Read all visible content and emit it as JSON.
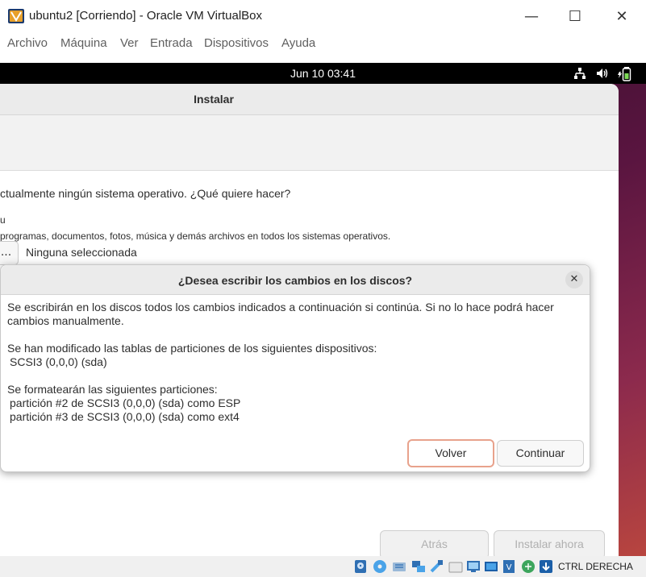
{
  "window": {
    "title": "ubuntu2 [Corriendo] - Oracle VM VirtualBox",
    "controls": {
      "minimize": "—",
      "maximize": "☐",
      "close": "✕"
    }
  },
  "menubar": {
    "items": [
      "Archivo",
      "Máquina",
      "Ver",
      "Entrada",
      "Dispositivos",
      "Ayuda"
    ]
  },
  "guest": {
    "topbar": {
      "datetime": "Jun 10  03:41"
    },
    "installer": {
      "title": "Instalar",
      "question": "ctualmente ningún sistema operativo. ¿Qué quiere hacer?",
      "option_label": "u",
      "option_desc": "programas, documentos, fotos, música y demás archivos en todos los sistemas operativos.",
      "select_button": "...",
      "select_label": "Ninguna seleccionada",
      "back_button": "Atrás",
      "install_button": "Instalar ahora"
    },
    "dialog": {
      "title": "¿Desea escribir los cambios en los discos?",
      "close": "✕",
      "intro_line1": "Se escribirán en los discos todos los cambios indicados a continuación si continúa. Si no lo hace podrá hacer",
      "intro_line2": "cambios manualmente.",
      "tables_heading": "Se han modificado las tablas de particiones de los siguientes dispositivos:",
      "tables_device": "SCSI3 (0,0,0) (sda)",
      "format_heading": "Se formatearán las siguientes particiones:",
      "format_items": [
        "partición #2 de SCSI3 (0,0,0) (sda) como ESP",
        "partición #3 de SCSI3 (0,0,0) (sda) como ext4"
      ],
      "back_button": "Volver",
      "continue_button": "Continuar"
    }
  },
  "statusbar": {
    "icons": [
      "hard-disk-icon",
      "optical-drive-icon",
      "audio-icon",
      "network-icon",
      "usb-icon",
      "shared-folders-icon",
      "display-icon",
      "recording-icon",
      "cpu-icon",
      "mouse-integration-icon",
      "keyboard-icon"
    ],
    "host_key": "CTRL DERECHA"
  },
  "colors": {
    "guest_background": "#5a1540",
    "accent_focus": "#e8a28c"
  }
}
